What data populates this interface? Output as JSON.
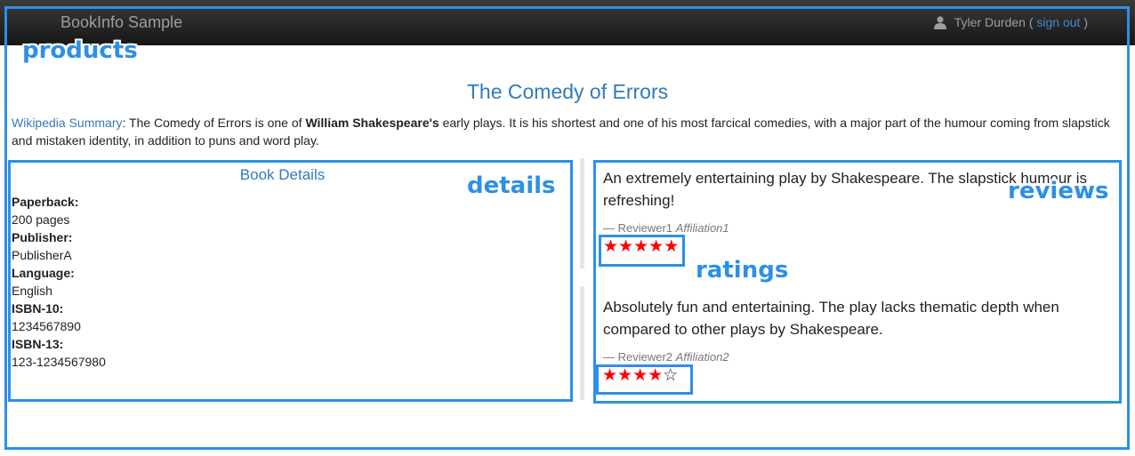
{
  "navbar": {
    "brand": "BookInfo Sample",
    "user_name": "Tyler Durden",
    "open_paren": "(",
    "sign_out": "sign out",
    "close_paren": ")"
  },
  "annotations": {
    "products": "products",
    "details": "details",
    "reviews": "reviews",
    "ratings": "ratings"
  },
  "product": {
    "title": "The Comedy of Errors",
    "summary_link": "Wikipedia Summary",
    "summary_pre": ": The Comedy of Errors is one of ",
    "summary_bold": "William Shakespeare's",
    "summary_post": " early plays. It is his shortest and one of his most farcical comedies, with a major part of the humour coming from slapstick and mistaken identity, in addition to puns and word play."
  },
  "details": {
    "heading": "Book Details",
    "items": [
      {
        "label": "Paperback:",
        "value": "200 pages"
      },
      {
        "label": "Publisher:",
        "value": "PublisherA"
      },
      {
        "label": "Language:",
        "value": "English"
      },
      {
        "label": "ISBN-10:",
        "value": "1234567890"
      },
      {
        "label": "ISBN-13:",
        "value": "123-1234567980"
      }
    ]
  },
  "reviews": [
    {
      "text": "An extremely entertaining play by Shakespeare. The slapstick humour is refreshing!",
      "reviewer": "— Reviewer1",
      "affiliation": "Affiliation1",
      "rating": 5,
      "max_rating": 5
    },
    {
      "text": "Absolutely fun and entertaining. The play lacks thematic depth when compared to other plays by Shakespeare.",
      "reviewer": "— Reviewer2",
      "affiliation": "Affiliation2",
      "rating": 4,
      "max_rating": 5
    }
  ],
  "colors": {
    "annotation": "#2d8fe7",
    "link": "#337ab7",
    "star_full": "#ff0000",
    "navbar": "#222222"
  }
}
